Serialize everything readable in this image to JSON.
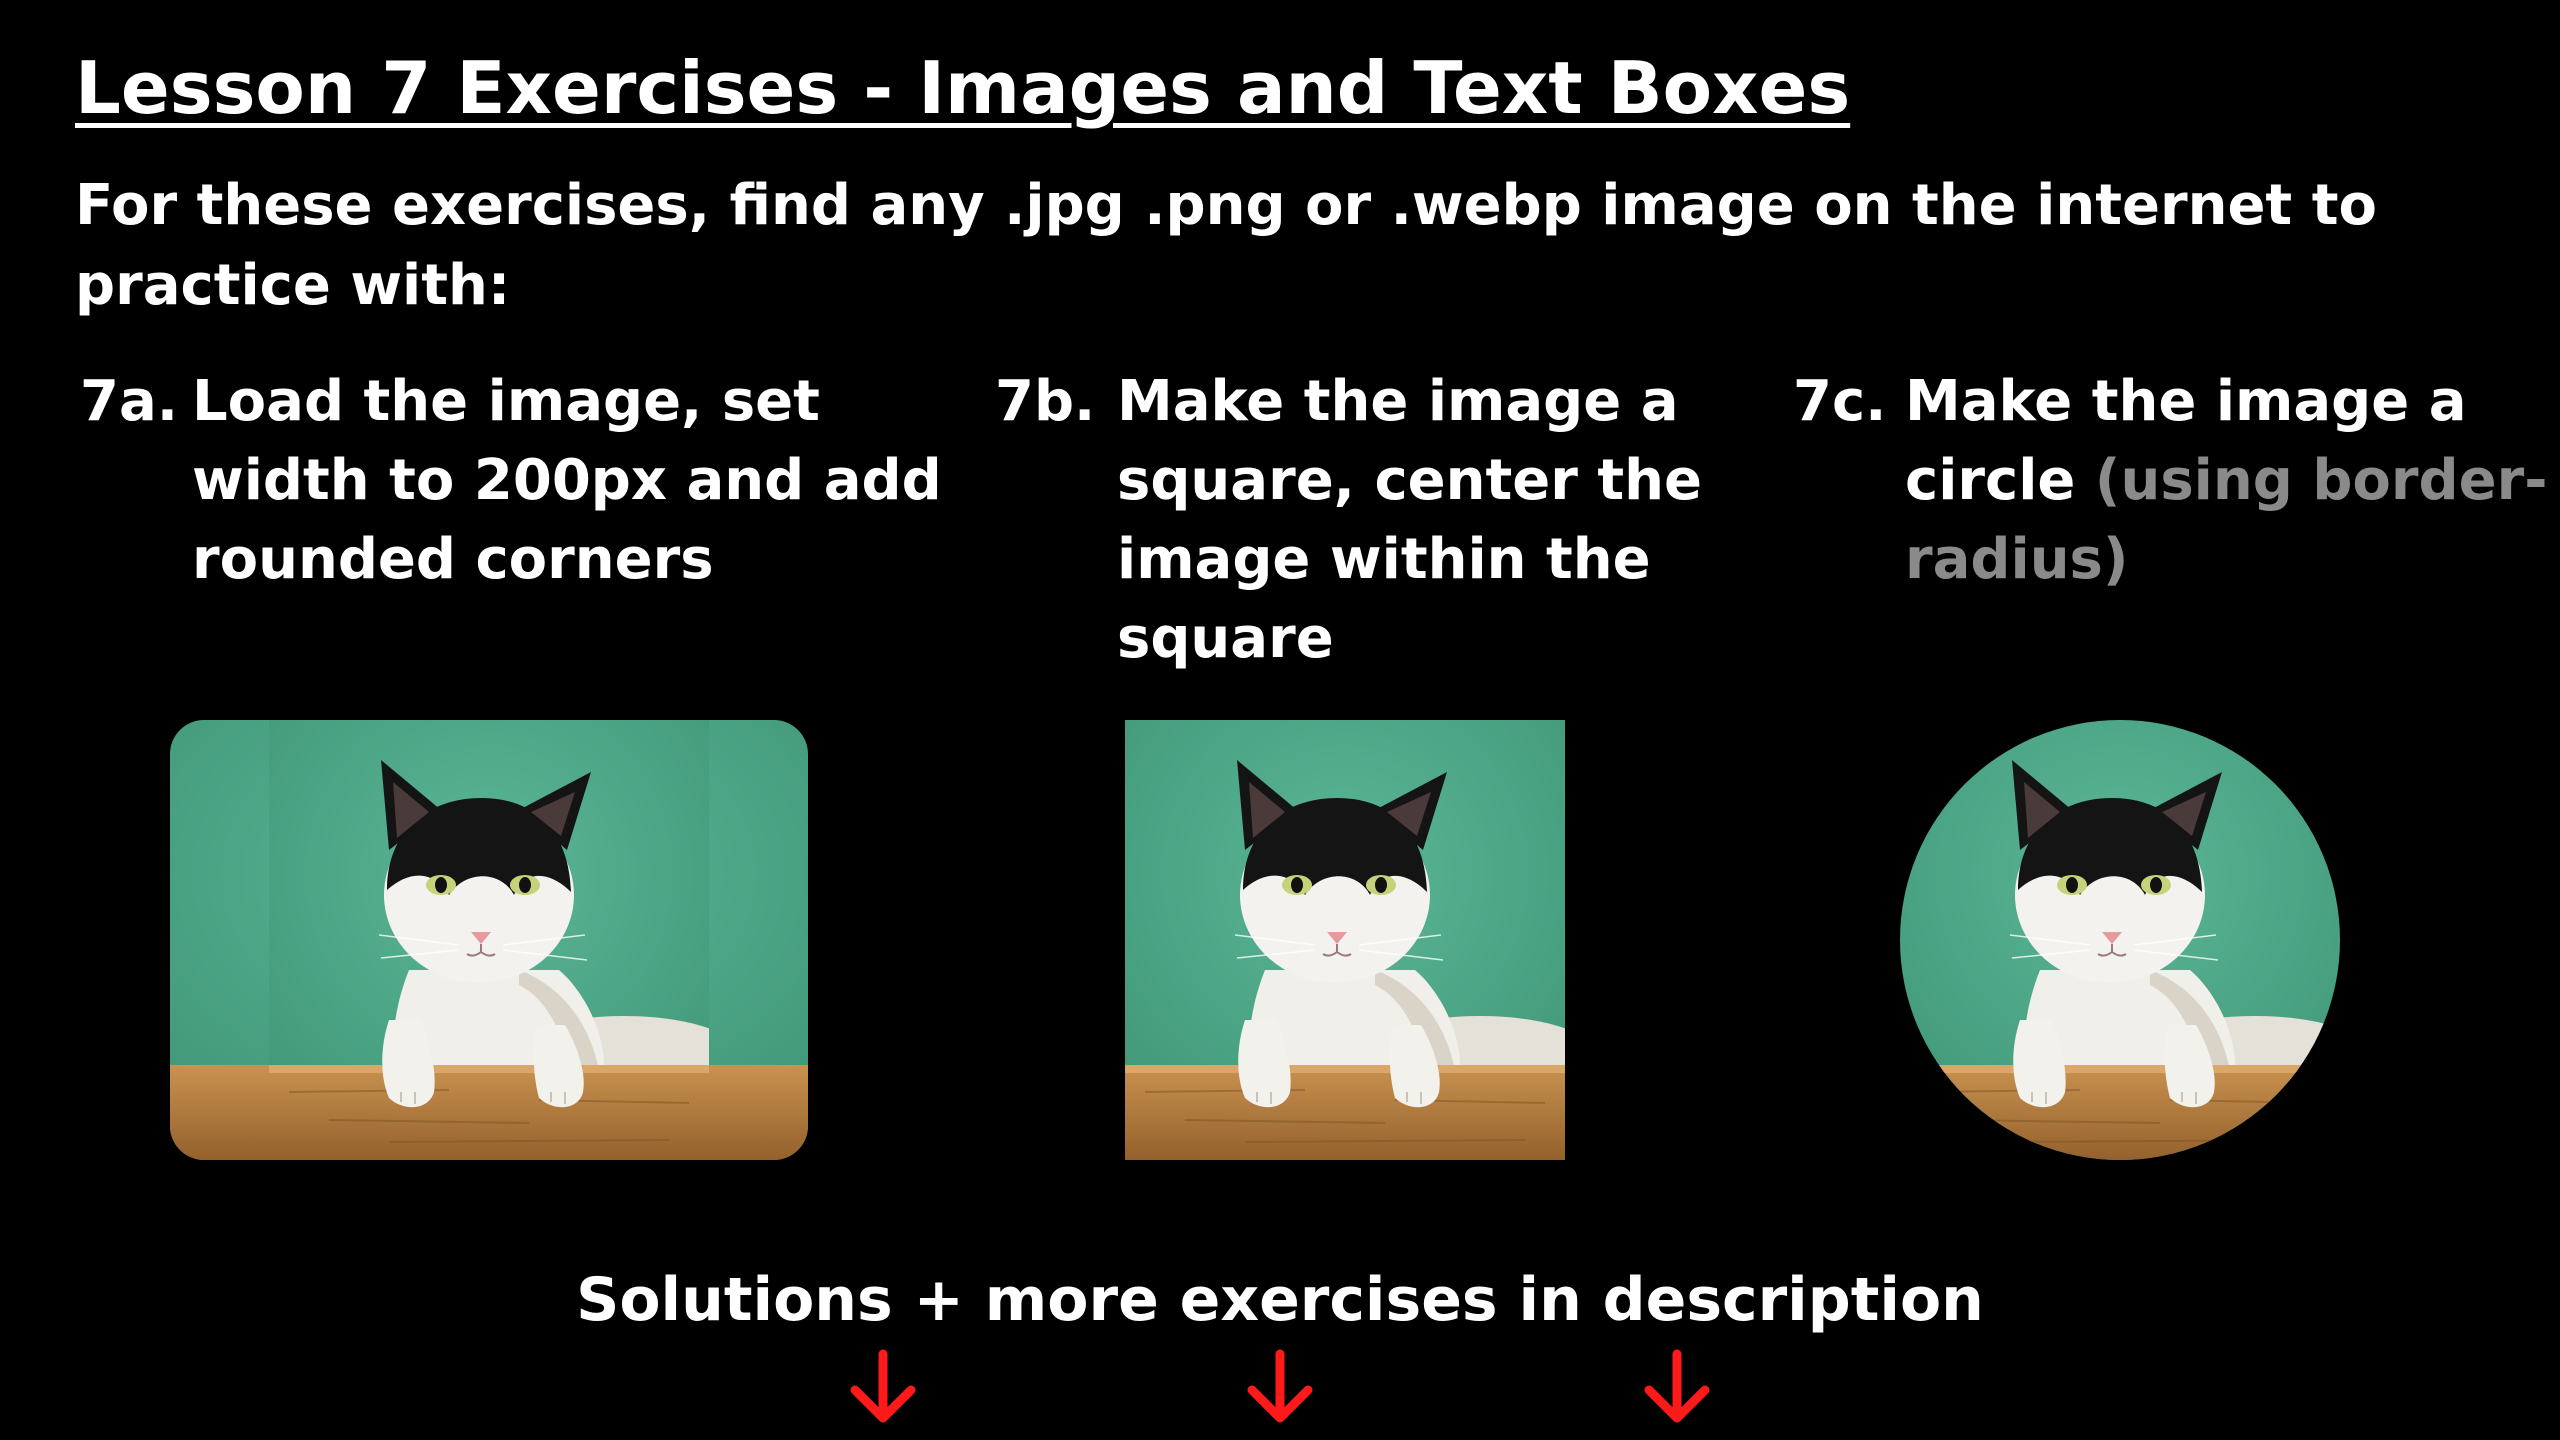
{
  "title": "Lesson 7 Exercises - Images and Text Boxes",
  "intro": "For these exercises, find any .jpg .png or .webp image on the internet to practice with:",
  "exercises": [
    {
      "number": "7a.",
      "text": "Load the image, set width to 200px and add rounded corners",
      "note": ""
    },
    {
      "number": "7b.",
      "text": "Make the image a square, center the image within the square",
      "note": ""
    },
    {
      "number": "7c.",
      "text": "Make the image a circle",
      "note": "(using border-radius)"
    }
  ],
  "footer": "Solutions + more exercises in description",
  "arrow_icon": "arrow-down-icon",
  "colors": {
    "background": "#000000",
    "text": "#ffffff",
    "muted_text": "#8a8a8a",
    "arrow": "#ff1a1a",
    "photo_wall": "#4faa8a",
    "photo_wood": "#b07b42"
  }
}
